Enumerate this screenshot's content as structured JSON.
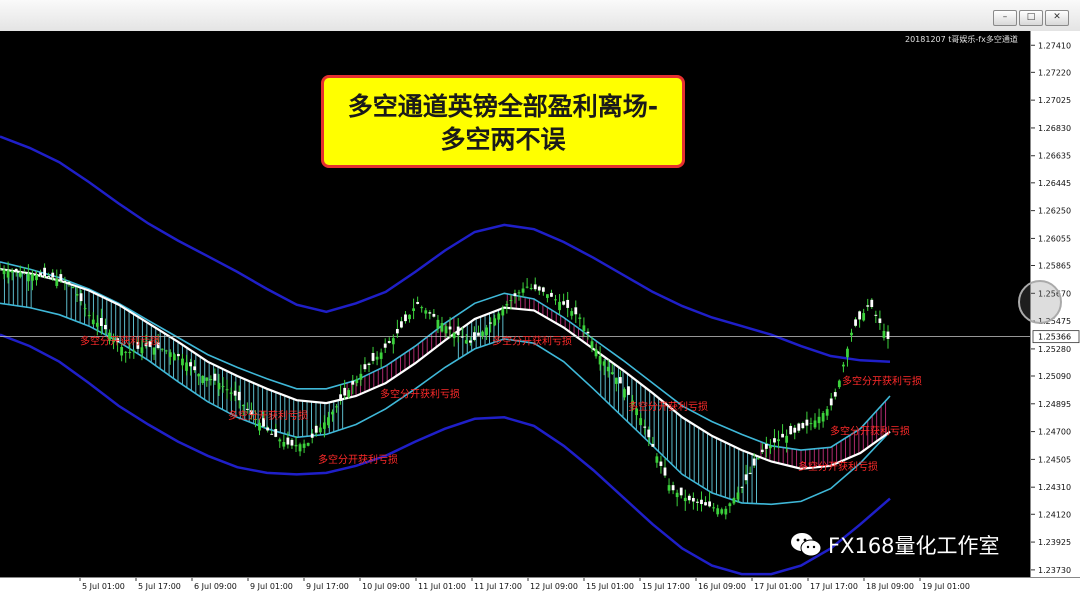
{
  "window": {
    "buttons": [
      "minimize-button",
      "restore-button",
      "close-button"
    ]
  },
  "indicator_label": "20181207 t哥娱乐-fx多空通道",
  "banner": {
    "line1": "多空通道英镑全部盈利离场-",
    "line2": "多空两不误"
  },
  "brand": {
    "icon": "wechat-icon",
    "name": "FX168量化工作室"
  },
  "signal_label": "多空分开获利亏损",
  "colors": {
    "background": "#000000",
    "bull_candle": "#3cd23c",
    "bear_candle": "#ffffff",
    "outer_band": "#1f1fc8",
    "inner_band": "#3fb8d8",
    "midline": "#ffffff",
    "sell_channel_fill": "#66d0e0",
    "buy_channel_fill": "#c0307a",
    "signal_text": "#ff2a2a",
    "banner_bg": "#ffff00",
    "banner_border": "#e53030"
  },
  "chart_data": {
    "type": "line",
    "symbol": "GBPUSD",
    "price_axis": {
      "ticks": [
        "1.27410",
        "1.27220",
        "1.27025",
        "1.26830",
        "1.26635",
        "1.26445",
        "1.26250",
        "1.26055",
        "1.25865",
        "1.25670",
        "1.25475",
        "1.25280",
        "1.25090",
        "1.24895",
        "1.24700",
        "1.24505",
        "1.24310",
        "1.24120",
        "1.23925",
        "1.23730"
      ],
      "current_price": "1.25366",
      "ylim": [
        1.2368,
        1.2751
      ]
    },
    "time_axis": {
      "ticks": [
        "5 Jul 01:00",
        "5 Jul 17:00",
        "6 Jul 09:00",
        "9 Jul 01:00",
        "9 Jul 17:00",
        "10 Jul 09:00",
        "11 Jul 01:00",
        "11 Jul 17:00",
        "12 Jul 09:00",
        "15 Jul 01:00",
        "15 Jul 17:00",
        "16 Jul 09:00",
        "17 Jul 01:00",
        "17 Jul 17:00",
        "18 Jul 09:00",
        "19 Jul 01:00"
      ]
    },
    "price_series": {
      "name": "",
      "values": [
        1.2584,
        1.2582,
        1.258,
        1.2578,
        1.2572,
        1.255,
        1.254,
        1.2525,
        1.253,
        1.2528,
        1.2522,
        1.251,
        1.2505,
        1.2495,
        1.248,
        1.2468,
        1.246,
        1.2462,
        1.2478,
        1.2495,
        1.2512,
        1.2525,
        1.254,
        1.256,
        1.255,
        1.254,
        1.2532,
        1.2545,
        1.256,
        1.2572,
        1.2568,
        1.256,
        1.255,
        1.2525,
        1.2508,
        1.249,
        1.246,
        1.243,
        1.2422,
        1.2418,
        1.2415,
        1.2432,
        1.2455,
        1.2465,
        1.247,
        1.2478,
        1.249,
        1.254,
        1.256,
        1.2535
      ]
    },
    "outer_upper_band": [
      1.2677,
      1.2669,
      1.2659,
      1.2645,
      1.263,
      1.2616,
      1.2604,
      1.2593,
      1.2582,
      1.257,
      1.2559,
      1.2554,
      1.256,
      1.2568,
      1.2582,
      1.2597,
      1.261,
      1.2615,
      1.2612,
      1.2603,
      1.2592,
      1.258,
      1.2568,
      1.2558,
      1.255,
      1.2544,
      1.2538,
      1.253,
      1.2523,
      1.252,
      1.2519
    ],
    "inner_upper_band": [
      1.2589,
      1.2584,
      1.2578,
      1.257,
      1.256,
      1.2548,
      1.2536,
      1.2524,
      1.2515,
      1.2507,
      1.25,
      1.25,
      1.2506,
      1.2516,
      1.253,
      1.2546,
      1.256,
      1.2567,
      1.2563,
      1.255,
      1.2535,
      1.252,
      1.2504,
      1.2488,
      1.2477,
      1.2468,
      1.246,
      1.2457,
      1.2459,
      1.2472,
      1.2495
    ],
    "midline": [
      1.2584,
      1.2581,
      1.2576,
      1.2569,
      1.2559,
      1.2546,
      1.2533,
      1.2519,
      1.2509,
      1.25,
      1.2492,
      1.249,
      1.2495,
      1.2504,
      1.2518,
      1.2534,
      1.2549,
      1.2557,
      1.2555,
      1.2543,
      1.2528,
      1.2513,
      1.2497,
      1.248,
      1.2467,
      1.2457,
      1.2449,
      1.2444,
      1.2446,
      1.2455,
      1.247
    ],
    "inner_lower_band": [
      1.256,
      1.2557,
      1.2552,
      1.2544,
      1.2533,
      1.252,
      1.2505,
      1.2491,
      1.248,
      1.2472,
      1.2466,
      1.2468,
      1.2475,
      1.2486,
      1.25,
      1.2515,
      1.2528,
      1.2535,
      1.2532,
      1.2519,
      1.25,
      1.248,
      1.246,
      1.244,
      1.2427,
      1.242,
      1.2419,
      1.2421,
      1.243,
      1.2448,
      1.247
    ],
    "outer_lower_band": [
      1.2538,
      1.253,
      1.2519,
      1.2504,
      1.2488,
      1.2475,
      1.2463,
      1.2453,
      1.2445,
      1.2441,
      1.244,
      1.2441,
      1.2446,
      1.2453,
      1.2463,
      1.2472,
      1.2479,
      1.248,
      1.2474,
      1.246,
      1.2443,
      1.2424,
      1.2405,
      1.2388,
      1.2376,
      1.237,
      1.237,
      1.2376,
      1.2388,
      1.2405,
      1.2423
    ],
    "grid": false
  }
}
